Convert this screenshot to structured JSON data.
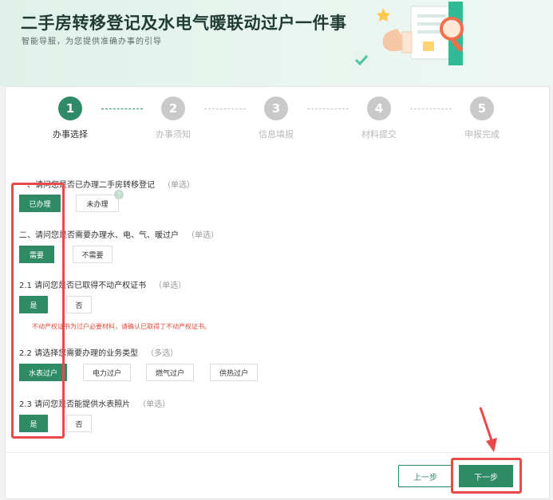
{
  "header": {
    "title": "二手房转移登记及水电气暖联动过户一件事",
    "subtitle": "智能导服，为您提供准确办事的引导"
  },
  "steps": [
    {
      "num": "1",
      "label": "办事选择",
      "active": true
    },
    {
      "num": "2",
      "label": "办事须知",
      "active": false
    },
    {
      "num": "3",
      "label": "信息填报",
      "active": false
    },
    {
      "num": "4",
      "label": "材料提交",
      "active": false
    },
    {
      "num": "5",
      "label": "申报完成",
      "active": false
    }
  ],
  "questions": {
    "q1": {
      "title": "一、请问您是否已办理二手房转移登记",
      "hint": "（单选）",
      "options": [
        "已办理",
        "未办理"
      ],
      "selected": "已办理"
    },
    "q2": {
      "title": "二、请问您是否需要办理水、电、气、暖过户",
      "hint": "（单选）",
      "options": [
        "需要",
        "不需要"
      ],
      "selected": "需要"
    },
    "q21": {
      "title": "2.1 请问您是否已取得不动产权证书",
      "hint": "（单选）",
      "options": [
        "是",
        "否"
      ],
      "selected": "是",
      "warning": "不动产权证书为过户必要材料，请确认已取得了不动产权证书。"
    },
    "q22": {
      "title": "2.2 请选择您需要办理的业务类型",
      "hint": "（多选）",
      "options": [
        "水表过户",
        "电力过户",
        "燃气过户",
        "供热过户"
      ],
      "selected": "水表过户"
    },
    "q23": {
      "title": "2.3 请问您是否能提供水表照片",
      "hint": "（单选）",
      "options": [
        "是",
        "否"
      ],
      "selected": "是"
    }
  },
  "help_badge": "?",
  "footer": {
    "prev_label": "上一步",
    "next_label": "下一步"
  },
  "colors": {
    "accent": "#2e8b66",
    "highlight": "#e84a4a",
    "warning": "#e24a3b"
  }
}
